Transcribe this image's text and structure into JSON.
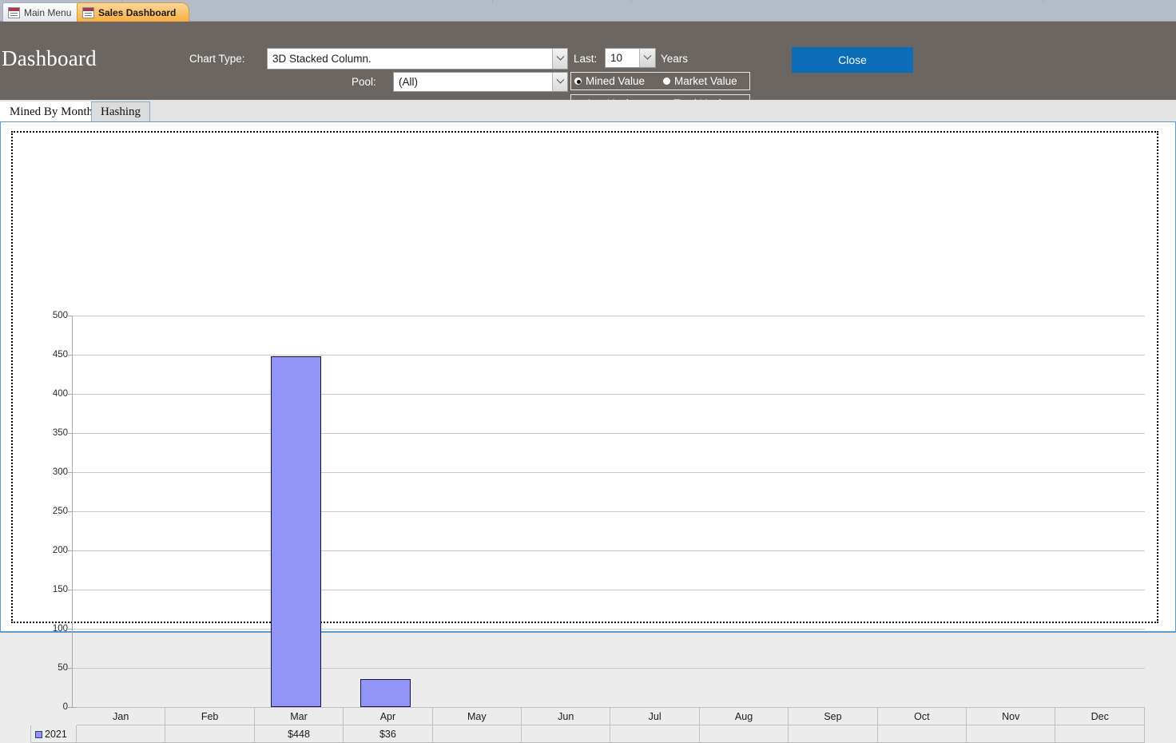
{
  "window": {
    "doc_tabs": [
      {
        "label": "Main Menu",
        "active": false,
        "icon": "form-icon"
      },
      {
        "label": "Sales Dashboard",
        "active": true,
        "icon": "form-icon"
      }
    ]
  },
  "header": {
    "title": "Dashboard",
    "chart_type_label": "Chart Type:",
    "chart_type_value": "3D Stacked Column.",
    "pool_label": "Pool:",
    "pool_value": "(All)",
    "last_label": "Last:",
    "last_value": "10",
    "years_label": "Years",
    "value_mode": [
      {
        "label": "Mined Value",
        "selected": true
      },
      {
        "label": "Market Value",
        "selected": false
      }
    ],
    "hash_mode": [
      {
        "label": "Avg Hash",
        "selected": false
      },
      {
        "label": "Total Hash",
        "selected": true
      }
    ],
    "close_label": "Close",
    "accent_color": "#0b6cb7",
    "panel_color": "#6b6661"
  },
  "form_tabs": [
    {
      "label": "Mined By Month",
      "active": true
    },
    {
      "label": "Hashing",
      "active": false
    }
  ],
  "chart_data": {
    "type": "bar",
    "title": "",
    "xlabel": "",
    "ylabel": "",
    "categories": [
      "Jan",
      "Feb",
      "Mar",
      "Apr",
      "May",
      "Jun",
      "Jul",
      "Aug",
      "Sep",
      "Oct",
      "Nov",
      "Dec"
    ],
    "series": [
      {
        "name": "2021",
        "color": "#9494f7",
        "values": [
          null,
          null,
          448,
          36,
          null,
          null,
          null,
          null,
          null,
          null,
          null,
          null
        ],
        "labels": [
          "",
          "",
          "$448",
          "$36",
          "",
          "",
          "",
          "",
          "",
          "",
          "",
          ""
        ]
      }
    ],
    "ylim": [
      0,
      500
    ],
    "yticks": [
      0,
      50,
      100,
      150,
      200,
      250,
      300,
      350,
      400,
      450,
      500
    ],
    "grid": true,
    "legend": "data-table",
    "data_table_visible": true
  }
}
